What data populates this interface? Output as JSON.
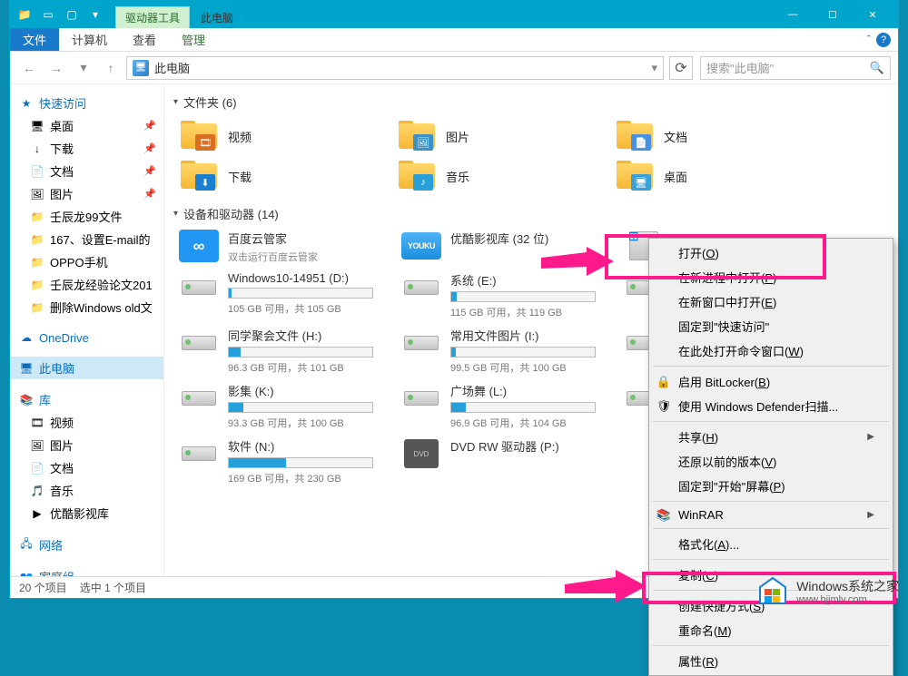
{
  "titlebar": {
    "tool_tab": "驱动器工具",
    "title": "此电脑"
  },
  "window_controls": {
    "min": "—",
    "max": "☐",
    "close": "✕"
  },
  "ribbon": {
    "file": "文件",
    "computer": "计算机",
    "view": "查看",
    "manage": "管理",
    "help_caret": "ˆ"
  },
  "navbar": {
    "breadcrumb": "此电脑",
    "search_placeholder": "搜索\"此电脑\""
  },
  "sidebar": {
    "quick_access": "快速访问",
    "items_qa": [
      {
        "label": "桌面",
        "icon": "🖥"
      },
      {
        "label": "下载",
        "icon": "↓"
      },
      {
        "label": "文档",
        "icon": "📄"
      },
      {
        "label": "图片",
        "icon": "🖼"
      },
      {
        "label": "壬辰龙99文件",
        "icon": "📁"
      },
      {
        "label": "167、设置E-mail的",
        "icon": "📁"
      },
      {
        "label": "OPPO手机",
        "icon": "📁"
      },
      {
        "label": "壬辰龙经验论文201",
        "icon": "📁"
      },
      {
        "label": "删除Windows old文",
        "icon": "📁"
      }
    ],
    "onedrive": "OneDrive",
    "this_pc": "此电脑",
    "library": "库",
    "lib_items": [
      {
        "label": "视频",
        "icon": "🎞"
      },
      {
        "label": "图片",
        "icon": "🖼"
      },
      {
        "label": "文档",
        "icon": "📄"
      },
      {
        "label": "音乐",
        "icon": "🎵"
      },
      {
        "label": "优酷影视库",
        "icon": "▶"
      }
    ],
    "network": "网络",
    "homegroup": "家庭组"
  },
  "content": {
    "folders_header": "文件夹 (6)",
    "folders": [
      {
        "label": "视频",
        "badge": "#d96f22"
      },
      {
        "label": "图片",
        "badge": "#3a93c4"
      },
      {
        "label": "文档",
        "badge": "#4a90e2"
      },
      {
        "label": "下载",
        "badge": "#1b7fd1"
      },
      {
        "label": "音乐",
        "badge": "#2aa0d8"
      },
      {
        "label": "桌面",
        "badge": "#3aa0d8"
      }
    ],
    "devices_header": "设备和驱动器 (14)",
    "app_tiles": [
      {
        "name": "百度云管家",
        "sub": "双击运行百度云管家",
        "type": "baidu"
      },
      {
        "name": "优酷影视库 (32 位)",
        "sub": "",
        "type": "youku"
      },
      {
        "name": "",
        "sub": "",
        "type": "osdrive"
      }
    ],
    "drives": [
      {
        "name": "Windows10-14951 (D:)",
        "fill": 2,
        "warn": false,
        "stats": "105 GB 可用，共 105 GB"
      },
      {
        "name": "系统 (E:)",
        "fill": 4,
        "warn": false,
        "stats": "115 GB 可用，共 119 GB"
      },
      {
        "name": "",
        "fill": 0,
        "warn": false,
        "stats": ""
      },
      {
        "name": "同学聚会文件 (H:)",
        "fill": 8,
        "warn": false,
        "stats": "96.3 GB 可用，共 101 GB"
      },
      {
        "name": "常用文件图片 (I:)",
        "fill": 3,
        "warn": false,
        "stats": "99.5 GB 可用，共 100 GB"
      },
      {
        "name": "",
        "fill": 0,
        "warn": false,
        "stats": ""
      },
      {
        "name": "影集 (K:)",
        "fill": 10,
        "warn": false,
        "stats": "93.3 GB 可用，共 100 GB"
      },
      {
        "name": "广场舞 (L:)",
        "fill": 10,
        "warn": false,
        "stats": "96.9 GB 可用，共 104 GB"
      },
      {
        "name": "",
        "fill": 0,
        "warn": false,
        "stats": ""
      },
      {
        "name": "软件 (N:)",
        "fill": 40,
        "warn": false,
        "stats": "169 GB 可用，共 230 GB"
      },
      {
        "name": "DVD RW 驱动器 (P:)",
        "fill": 0,
        "warn": false,
        "stats": "",
        "dvd": true
      }
    ]
  },
  "context_menu": {
    "items": [
      {
        "label": "打开(",
        "key": "O",
        "tail": ")"
      },
      {
        "label": "在新进程中打开(",
        "key": "P",
        "tail": ")"
      },
      {
        "label": "在新窗口中打开(",
        "key": "E",
        "tail": ")"
      },
      {
        "label": "固定到\"快速访问\"",
        "key": "",
        "tail": ""
      },
      {
        "label": "在此处打开命令窗口(",
        "key": "W",
        "tail": ")"
      },
      {
        "sep": true
      },
      {
        "label": "启用 BitLocker(",
        "key": "B",
        "tail": ")",
        "icon": "🔒"
      },
      {
        "label": "使用 Windows Defender扫描...",
        "key": "",
        "tail": "",
        "icon": "🛡"
      },
      {
        "sep": true
      },
      {
        "label": "共享(",
        "key": "H",
        "tail": ")",
        "arrow": true
      },
      {
        "label": "还原以前的版本(",
        "key": "V",
        "tail": ")"
      },
      {
        "label": "固定到\"开始\"屏幕(",
        "key": "P",
        "tail": ")"
      },
      {
        "sep": true
      },
      {
        "label": "WinRAR",
        "key": "",
        "tail": "",
        "icon": "📚",
        "arrow": true
      },
      {
        "sep": true
      },
      {
        "label": "格式化(",
        "key": "A",
        "tail": ")..."
      },
      {
        "sep": true
      },
      {
        "label": "复制(",
        "key": "C",
        "tail": ")"
      },
      {
        "sep": true
      },
      {
        "label": "创建快捷方式(",
        "key": "S",
        "tail": ")"
      },
      {
        "label": "重命名(",
        "key": "M",
        "tail": ")"
      },
      {
        "sep": true
      },
      {
        "label": "属性(",
        "key": "R",
        "tail": ")"
      }
    ]
  },
  "statusbar": {
    "count": "20 个项目",
    "selected": "选中 1 个项目"
  },
  "watermark": {
    "brand": "Windows系统之家",
    "url": "www.bjjmlv.com"
  }
}
